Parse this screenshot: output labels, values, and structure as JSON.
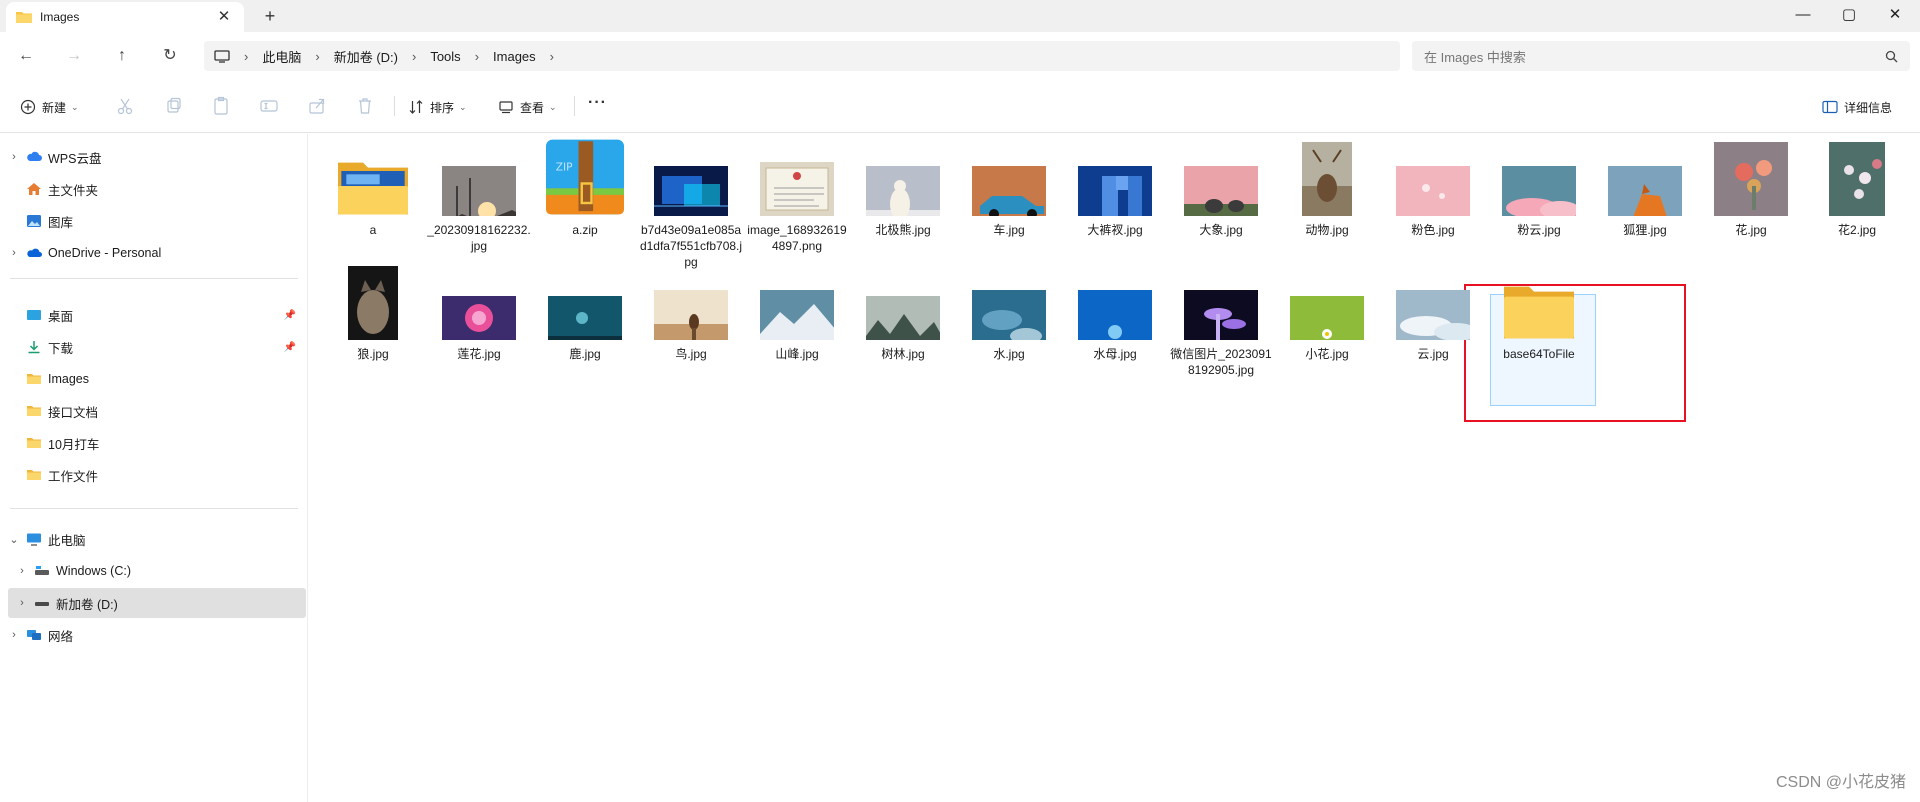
{
  "tab": {
    "title": "Images",
    "close": "✕",
    "new": "+"
  },
  "window": {
    "minimize": "—",
    "maximize": "▢",
    "close": "✕"
  },
  "nav": {
    "back": "←",
    "forward": "→",
    "up": "↑",
    "refresh": "↻"
  },
  "breadcrumb": [
    "此电脑",
    "新加卷 (D:)",
    "Tools",
    "Images"
  ],
  "search": {
    "placeholder": "在 Images 中搜索"
  },
  "toolbar": {
    "new_label": "新建",
    "sort_label": "排序",
    "view_label": "查看",
    "more_label": "···",
    "details_label": "详细信息"
  },
  "sidebar": {
    "cloud": [
      {
        "label": "WPS云盘",
        "chevron": "›"
      },
      {
        "label": "主文件夹",
        "chevron": ""
      },
      {
        "label": "图库",
        "chevron": ""
      },
      {
        "label": "OneDrive - Personal",
        "chevron": "›"
      }
    ],
    "pinned": [
      {
        "label": "桌面",
        "pin": "📌"
      },
      {
        "label": "下载",
        "pin": "📌"
      },
      {
        "label": "Images",
        "pin": ""
      },
      {
        "label": "接口文档",
        "pin": ""
      },
      {
        "label": "10月打车",
        "pin": ""
      },
      {
        "label": "工作文件",
        "pin": ""
      }
    ],
    "this_pc": {
      "label": "此电脑",
      "chevron": "⌄"
    },
    "drives": [
      {
        "label": "Windows (C:)",
        "chevron": "›"
      },
      {
        "label": "新加卷 (D:)",
        "chevron": "›"
      }
    ],
    "network": {
      "label": "网络",
      "chevron": "›"
    }
  },
  "files_row1": [
    {
      "name": "a",
      "kind": "folder-photo"
    },
    {
      "name": "_20230918162232.jpg",
      "kind": "sunset"
    },
    {
      "name": "a.zip",
      "kind": "zip"
    },
    {
      "name": "b7d43e09a1e085ad1dfa7f551cfb708.jpg",
      "kind": "tech"
    },
    {
      "name": "image_1689326194897.png",
      "kind": "certificate"
    },
    {
      "name": "北极熊.jpg",
      "kind": "bear"
    },
    {
      "name": "车.jpg",
      "kind": "car"
    },
    {
      "name": "大裤衩.jpg",
      "kind": "building"
    },
    {
      "name": "大象.jpg",
      "kind": "elephant"
    },
    {
      "name": "动物.jpg",
      "kind": "deer"
    },
    {
      "name": "粉色.jpg",
      "kind": "pink"
    },
    {
      "name": "粉云.jpg",
      "kind": "pinkcloud"
    },
    {
      "name": "狐狸.jpg",
      "kind": "fox"
    },
    {
      "name": "花.jpg",
      "kind": "flowers"
    },
    {
      "name": "花2.jpg",
      "kind": "flowers2"
    }
  ],
  "files_row2": [
    {
      "name": "狼.jpg",
      "kind": "wolf"
    },
    {
      "name": "莲花.jpg",
      "kind": "lotus"
    },
    {
      "name": "鹿.jpg",
      "kind": "night"
    },
    {
      "name": "鸟.jpg",
      "kind": "bird"
    },
    {
      "name": "山峰.jpg",
      "kind": "mountain"
    },
    {
      "name": "树林.jpg",
      "kind": "forest"
    },
    {
      "name": "水.jpg",
      "kind": "water"
    },
    {
      "name": "水母.jpg",
      "kind": "jelly"
    },
    {
      "name": "微信图片_20230918192905.jpg",
      "kind": "mushroom"
    },
    {
      "name": "小花.jpg",
      "kind": "smallflower"
    },
    {
      "name": "云.jpg",
      "kind": "cloud"
    },
    {
      "name": "base64ToFile",
      "kind": "folder"
    }
  ],
  "watermark": "CSDN @小花皮猪",
  "colors": {
    "highlight": "#e81123",
    "selection": "#99d1ff",
    "folder": "#f8c644"
  }
}
